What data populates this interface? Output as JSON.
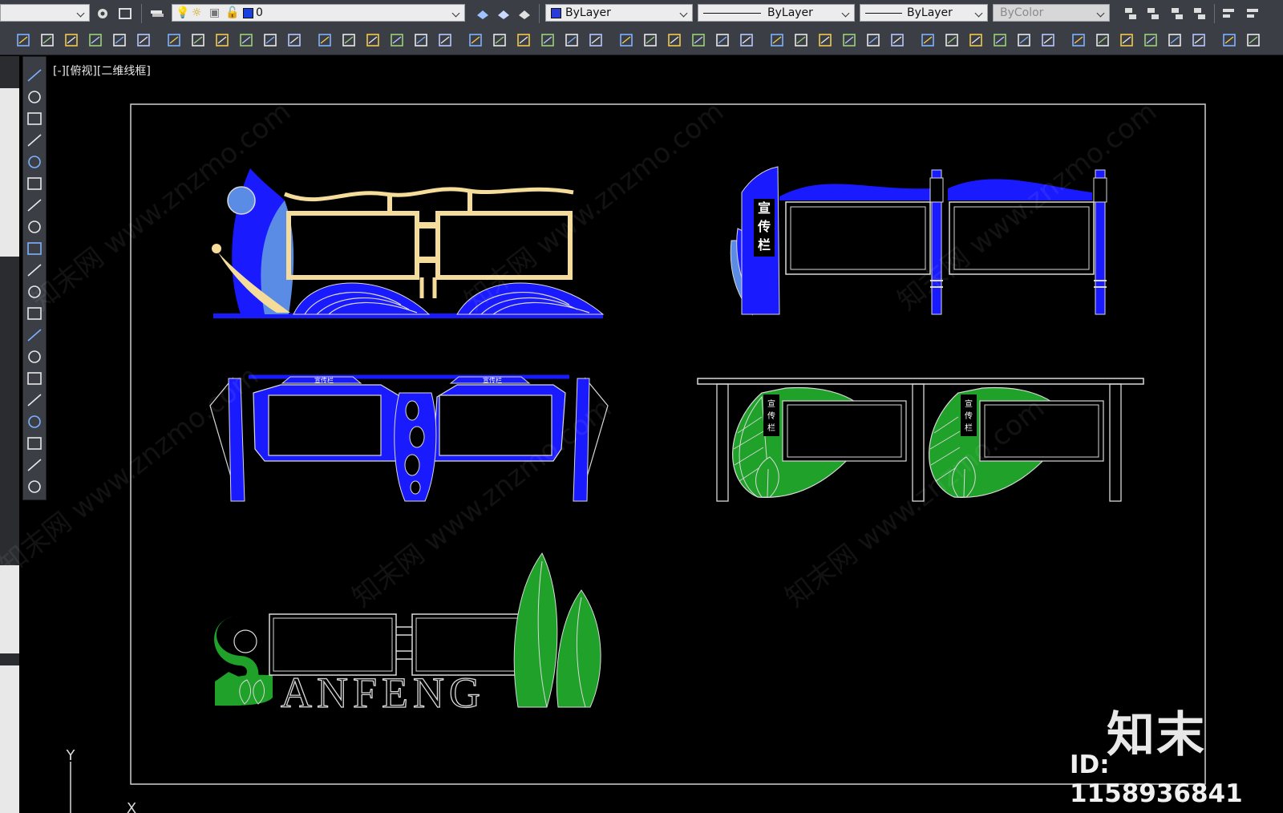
{
  "toolbar_top": {
    "layer_combo": {
      "value": "0"
    },
    "color_combo": {
      "value": "ByLayer"
    },
    "linetype_combo": {
      "value": "ByLayer"
    },
    "lineweight_combo": {
      "value": "ByLayer"
    },
    "plotstyle_combo": {
      "value": "ByColor"
    }
  },
  "viewport": {
    "label": "[-][俯视][二维线框]",
    "ucs_y_label": "Y",
    "ucs_x_label": "X"
  },
  "drawing": {
    "panel1_text": "宣传栏",
    "panel3_tab_left": "宣传栏",
    "panel3_tab_right": "宣传栏",
    "panel4_text_left": "宣传栏",
    "panel4_text_right": "宣传栏",
    "sanfeng_text": "ANFENG"
  },
  "watermark": {
    "text": "知末网 www.znzmo.com",
    "logo": "知末",
    "id_text": "ID: 1158936841"
  },
  "colors": {
    "blue": "#1a1aff",
    "light_blue": "#5a8ce6",
    "cream": "#f5dc9a",
    "green": "#1fa12a",
    "white_line": "#d9d9d9"
  }
}
